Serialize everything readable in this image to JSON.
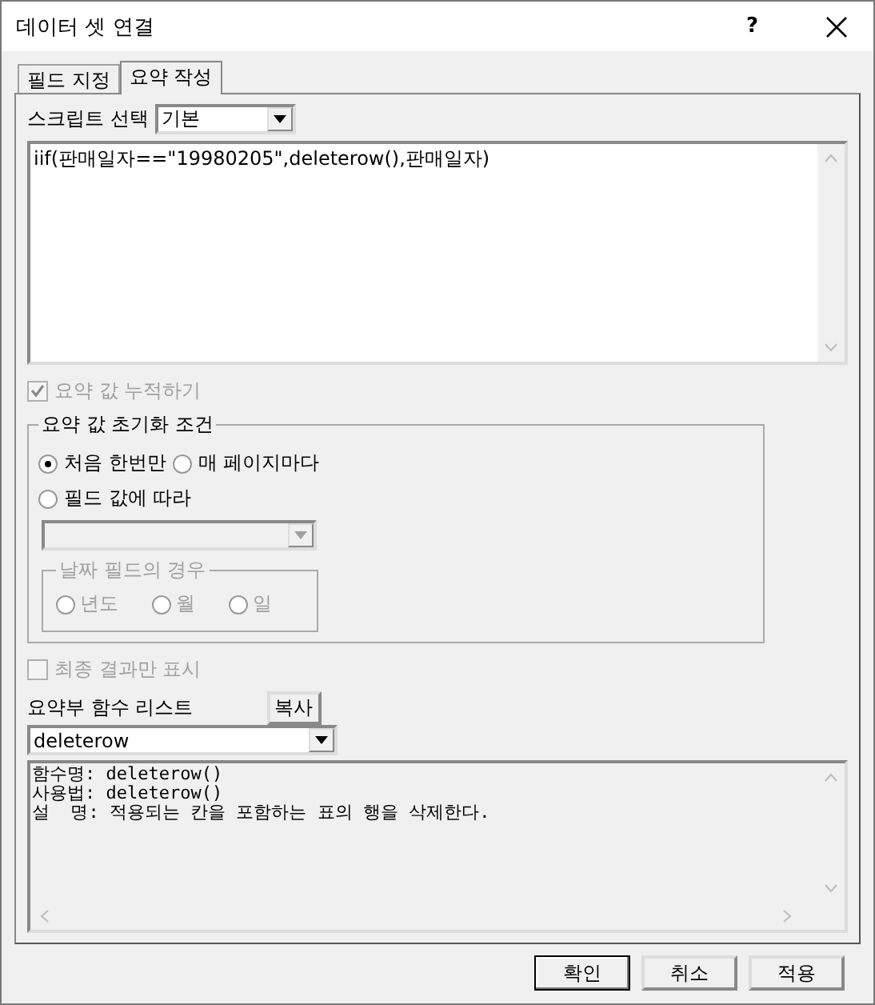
{
  "window": {
    "title": "데이터 셋 연결",
    "help": "?"
  },
  "tabs": [
    {
      "label": "필드 지정",
      "selected": false
    },
    {
      "label": "요약 작성",
      "selected": true
    }
  ],
  "script_select": {
    "label": "스크립트 선택",
    "value": "기본"
  },
  "script_editor": {
    "value": "iif(판매일자==\"19980205\",deleterow(),판매일자)"
  },
  "accumulate": {
    "label": "요약 값 누적하기",
    "checked": true,
    "disabled": true
  },
  "reset_group": {
    "title": "요약 값 초기화 조건",
    "options": [
      {
        "label": "처음 한번만",
        "selected": true
      },
      {
        "label": "매 페이지마다",
        "selected": false
      },
      {
        "label": "필드 값에 따라",
        "selected": false
      }
    ],
    "field_dropdown": {
      "disabled": true
    },
    "date_group": {
      "title": "날짜 필드의 경우",
      "disabled": true,
      "options": [
        {
          "label": "년도",
          "selected": false
        },
        {
          "label": "월",
          "selected": false
        },
        {
          "label": "일",
          "selected": false
        }
      ]
    }
  },
  "final_only": {
    "label": "최종 결과만 표시",
    "checked": false,
    "disabled": true
  },
  "function_list": {
    "label": "요약부 함수 리스트",
    "copy_button": "복사",
    "value": "deleterow"
  },
  "description": {
    "lines": [
      "함수명: deleterow()",
      "사용법: deleterow()",
      "설  명: 적용되는 칸을 포함하는 표의 행을 삭제한다."
    ]
  },
  "buttons": [
    {
      "label": "확인",
      "default": true
    },
    {
      "label": "취소",
      "default": false
    },
    {
      "label": "적용",
      "default": false
    }
  ]
}
